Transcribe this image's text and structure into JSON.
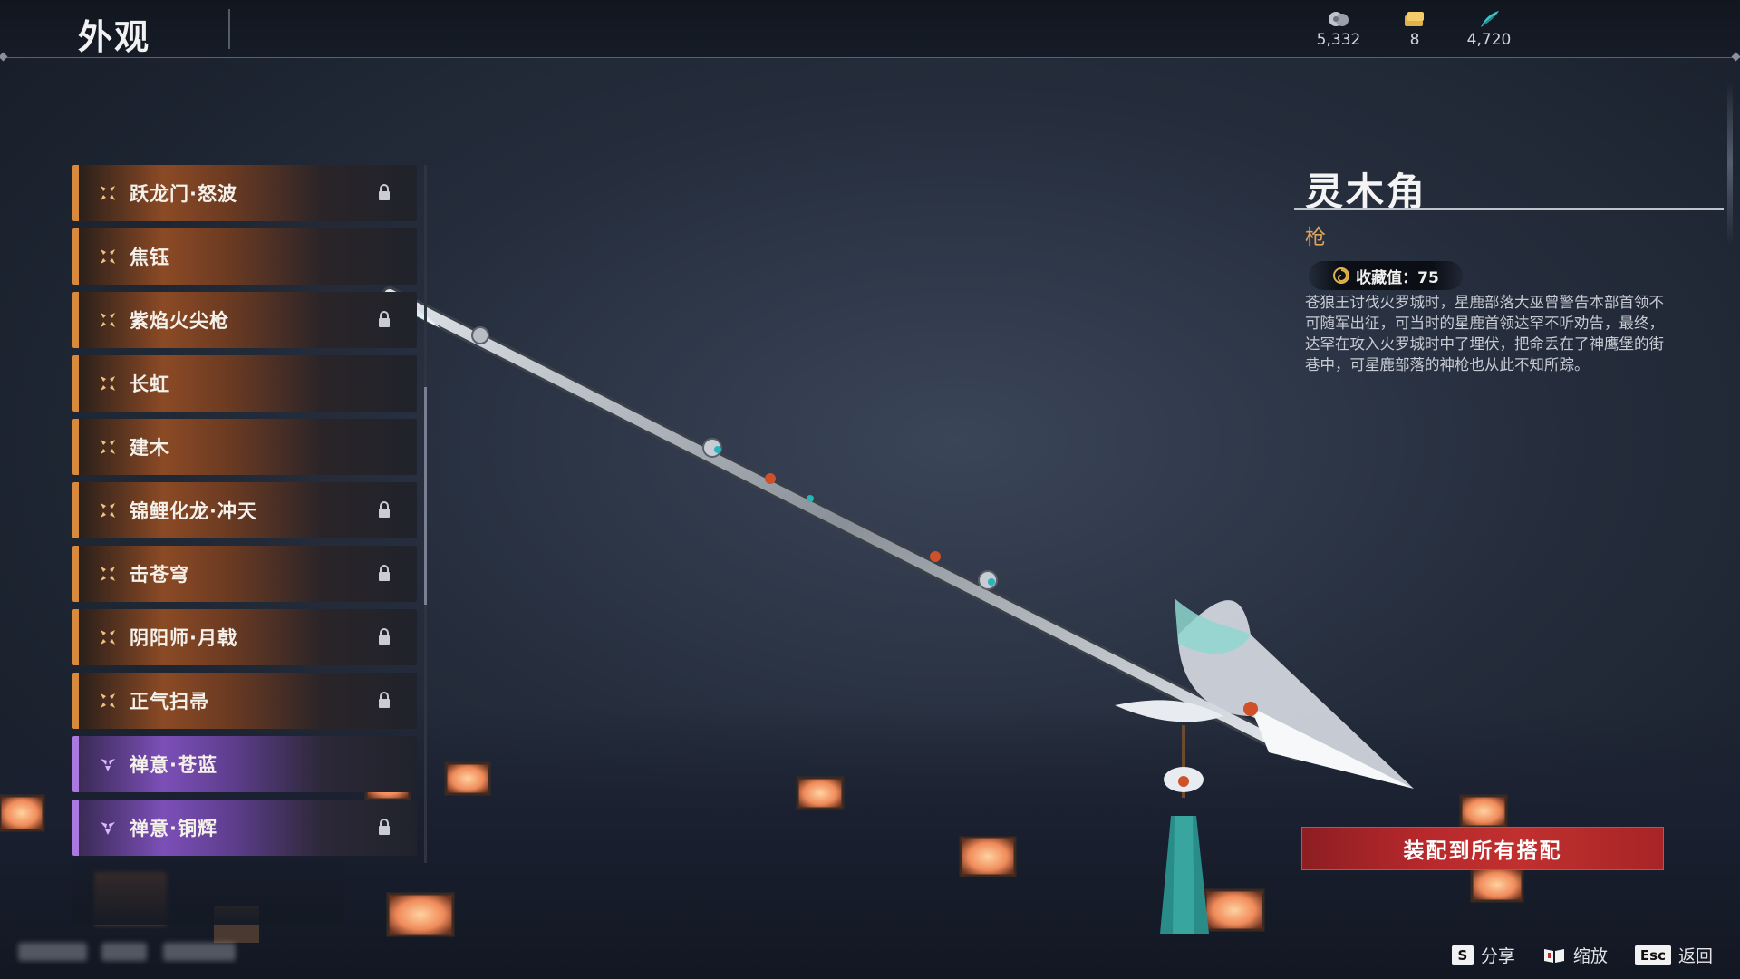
{
  "header": {
    "title": "外观"
  },
  "currencies": [
    {
      "icon": "silver-coin-icon",
      "value": "5,332"
    },
    {
      "icon": "gold-ticket-icon",
      "value": "8"
    },
    {
      "icon": "feather-token-icon",
      "value": "4,720"
    }
  ],
  "list": {
    "items": [
      {
        "label": "跃龙门·怒波",
        "rarity": "gold",
        "locked": true
      },
      {
        "label": "焦钰",
        "rarity": "gold",
        "locked": false
      },
      {
        "label": "紫焰火尖枪",
        "rarity": "gold",
        "locked": true
      },
      {
        "label": "长虹",
        "rarity": "gold",
        "locked": false
      },
      {
        "label": "建木",
        "rarity": "gold",
        "locked": false
      },
      {
        "label": "锦鲤化龙·冲天",
        "rarity": "gold",
        "locked": true
      },
      {
        "label": "击苍穹",
        "rarity": "gold",
        "locked": true
      },
      {
        "label": "阴阳师·月戟",
        "rarity": "gold",
        "locked": true
      },
      {
        "label": "正气扫帚",
        "rarity": "gold",
        "locked": true
      },
      {
        "label": "禅意·苍蓝",
        "rarity": "purple",
        "locked": false
      },
      {
        "label": "禅意·铜辉",
        "rarity": "purple",
        "locked": true
      }
    ]
  },
  "detail": {
    "name": "灵木角",
    "type": "枪",
    "collection_label": "收藏值：75",
    "description": "苍狼王讨伐火罗城时，星鹿部落大巫曾警告本部首领不可随军出征，可当时的星鹿首领达罕不听劝告，最终，达罕在攻入火罗城时中了埋伏，把命丢在了神鹰堡的街巷中，可星鹿部落的神枪也从此不知所踪。"
  },
  "actions": {
    "equip_all": "装配到所有搭配"
  },
  "hints": [
    {
      "key": "S",
      "label": "分享",
      "icon": ""
    },
    {
      "key": "",
      "label": "缩放",
      "icon": "book-zoom-icon"
    },
    {
      "key": "Esc",
      "label": "返回",
      "icon": ""
    }
  ],
  "colors": {
    "gold_accent": "#d7893c",
    "purple_accent": "#a978e0",
    "type_color": "#e0a35a",
    "equip_button": "#b8292c"
  }
}
